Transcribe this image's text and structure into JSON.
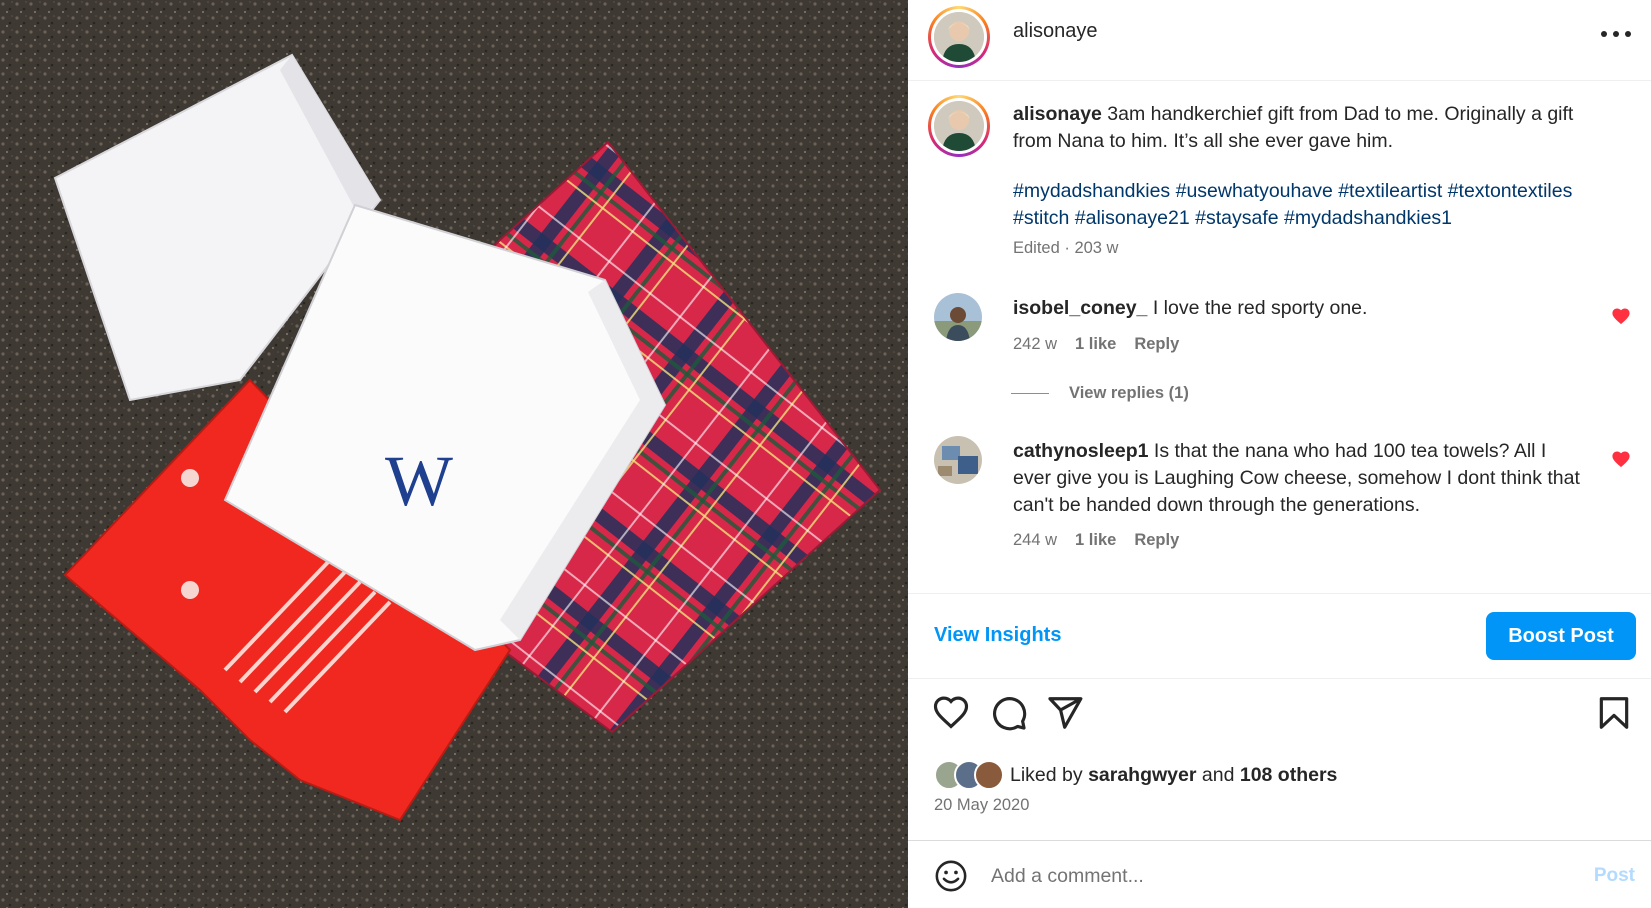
{
  "header": {
    "username": "alisonaye",
    "more_icon": "more-horizontal-icon"
  },
  "caption": {
    "username": "alisonaye",
    "text": " 3am handkerchief gift from Dad to me. Originally a gift from Nana to him. It’s all she ever gave him.",
    "hashtags": "#mydadshandkies #usewhatyouhave #textileartist #textontextiles #stitch #alisonaye21 #staysafe #mydadshandkies1",
    "meta": "Edited · 203 w"
  },
  "comments": [
    {
      "username": "isobel_coney_",
      "text": " I love the red sporty one.",
      "age": "242 w",
      "likes": "1 like",
      "reply": "Reply",
      "liked": true
    },
    {
      "username": "cathynosleep1",
      "text": " Is that the nana who had 100 tea towels? All I ever give you is Laughing Cow cheese, somehow I dont think that can't be handed down through the generations.",
      "age": "244 w",
      "likes": "1 like",
      "reply": "Reply",
      "liked": true
    }
  ],
  "view_replies": "View replies (1)",
  "insights": {
    "view_insights": "View Insights",
    "boost": "Boost Post"
  },
  "actions": {
    "like_icon": "heart-icon",
    "comment_icon": "comment-icon",
    "share_icon": "send-icon",
    "save_icon": "bookmark-icon"
  },
  "likes": {
    "prefix": "Liked by ",
    "user": "sarahgwyer",
    "middle": " and ",
    "others": "108 others"
  },
  "date": "20 May 2020",
  "add_comment": {
    "placeholder": "Add a comment...",
    "post": "Post"
  },
  "photo": {
    "monogram": "W"
  },
  "colors": {
    "accent": "#0095f6",
    "heart": "#ff3040",
    "text": "#262626",
    "muted": "#737373",
    "hashtag": "#00376b",
    "post_disabled": "#b3dbff"
  }
}
